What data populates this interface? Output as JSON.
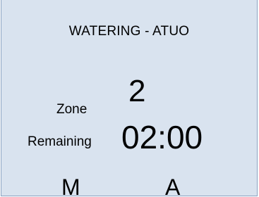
{
  "screen": {
    "title": "WATERING - ATUO",
    "zone_label": "Zone",
    "zone_value": "2",
    "remaining_label": "Remaining",
    "remaining_value": "02:00",
    "mode_manual": "M",
    "mode_auto": "A"
  },
  "colors": {
    "background": "#d9e3ef",
    "border": "#8aa2c1"
  }
}
